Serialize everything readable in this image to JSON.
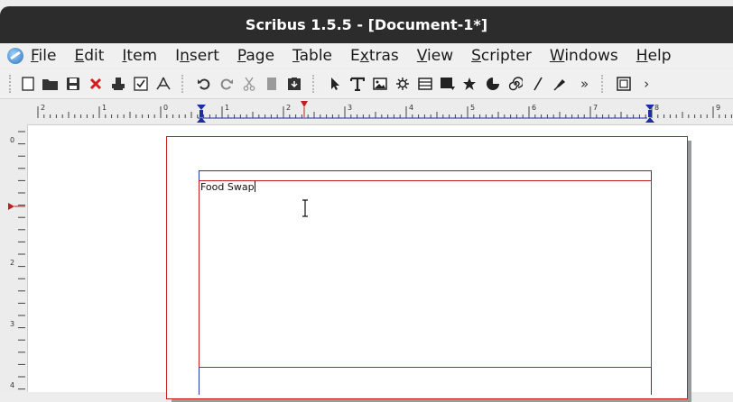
{
  "window": {
    "title": "Scribus 1.5.5 - [Document-1*]"
  },
  "menubar": {
    "items": [
      {
        "pre": "",
        "mn": "F",
        "post": "ile"
      },
      {
        "pre": "",
        "mn": "E",
        "post": "dit"
      },
      {
        "pre": "",
        "mn": "I",
        "post": "tem"
      },
      {
        "pre": "I",
        "mn": "n",
        "post": "sert"
      },
      {
        "pre": "",
        "mn": "P",
        "post": "age"
      },
      {
        "pre": "",
        "mn": "T",
        "post": "able"
      },
      {
        "pre": "E",
        "mn": "x",
        "post": "tras"
      },
      {
        "pre": "",
        "mn": "V",
        "post": "iew"
      },
      {
        "pre": "",
        "mn": "S",
        "post": "cripter"
      },
      {
        "pre": "",
        "mn": "W",
        "post": "indows"
      },
      {
        "pre": "",
        "mn": "H",
        "post": "elp"
      }
    ]
  },
  "toolbar": {
    "more_label": "»",
    "more_label_right": "›"
  },
  "rulers": {
    "horizontal_labels": [
      "2",
      "1",
      "0",
      "1",
      "2",
      "3",
      "4",
      "5",
      "6",
      "7",
      "8",
      "9"
    ],
    "vertical_labels": [
      "0",
      "2",
      "3",
      "4"
    ]
  },
  "document": {
    "frame_text": "Food Swap"
  },
  "colors": {
    "frame_border": "#c02020",
    "margin_guide": "#2c3aa8",
    "ruler_marker": "#1c2fa0",
    "ruler_indicator": "#c02020"
  }
}
